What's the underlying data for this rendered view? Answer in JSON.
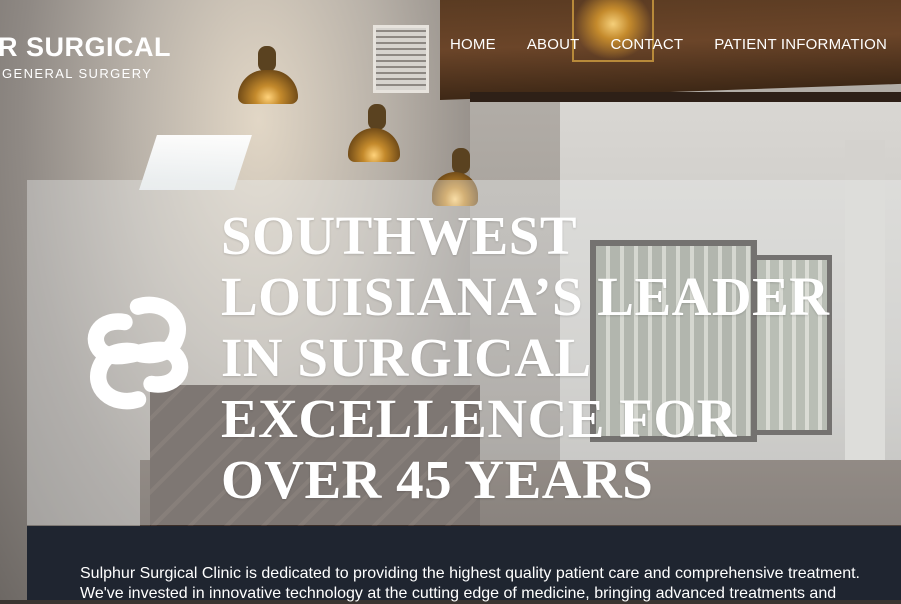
{
  "brand": {
    "name": "R SURGICAL",
    "tagline": "GENERAL SURGERY"
  },
  "nav": {
    "items": [
      {
        "label": "HOME"
      },
      {
        "label": "ABOUT"
      },
      {
        "label": "CONTACT"
      },
      {
        "label": "PATIENT INFORMATION"
      }
    ]
  },
  "hero": {
    "emblem_icon": "interlocking-s-logo-icon",
    "title": "SOUTHWEST LOUISIANA’S LEADER IN SURGICAL EXCELLENCE FOR OVER 45 YEARS"
  },
  "intro": {
    "text": "Sulphur Surgical Clinic is dedicated to providing the highest quality patient care and comprehensive treatment. We've invested in innovative technology at the cutting edge of medicine, bringing advanced treatments and"
  },
  "colors": {
    "overlay": "#eceef0",
    "info_band": "#1f2530",
    "text": "#ffffff"
  }
}
